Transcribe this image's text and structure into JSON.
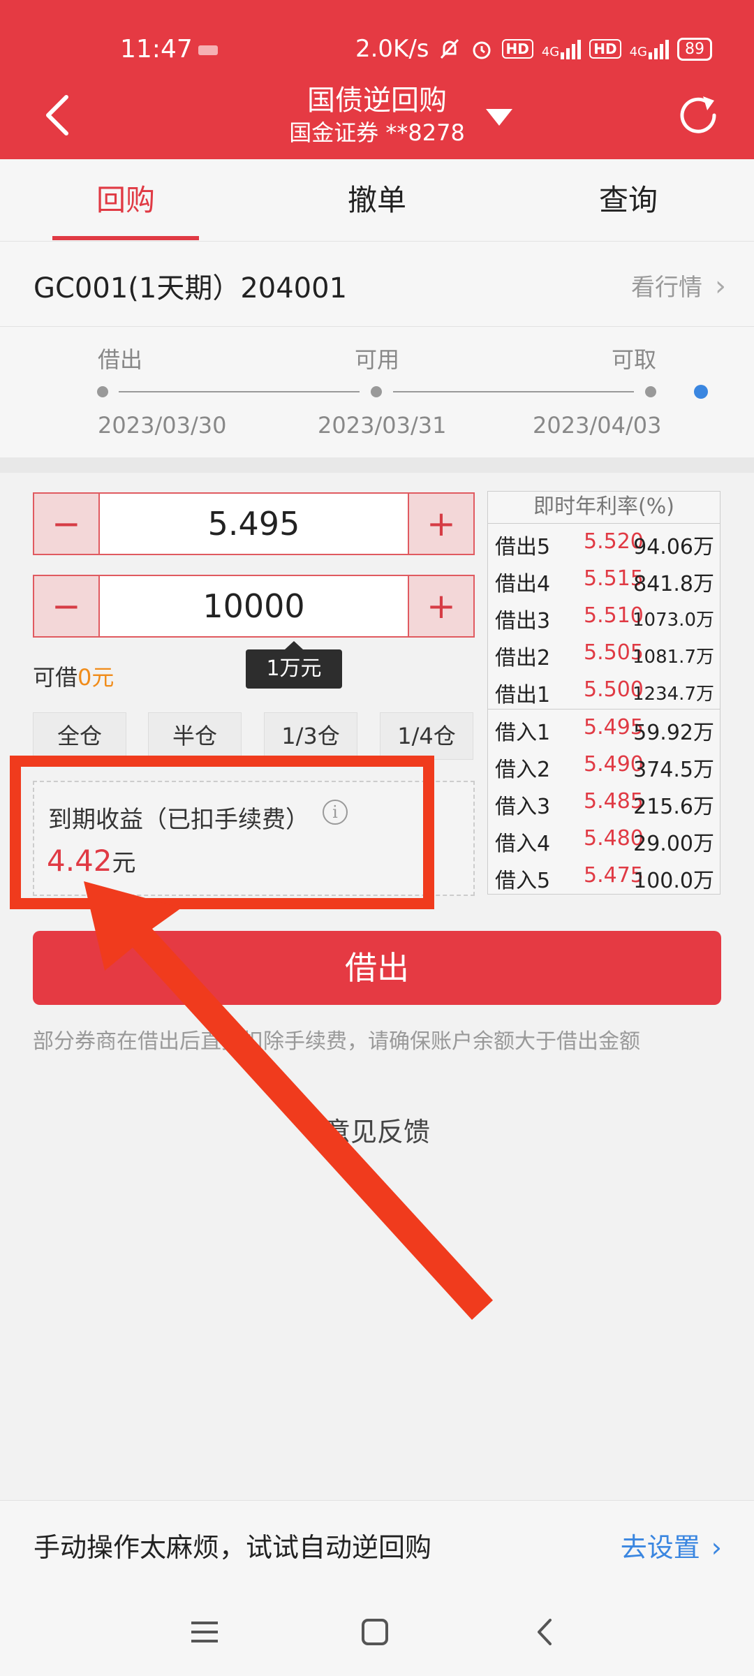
{
  "status_bar": {
    "time": "11:47",
    "net_speed": "2.0K/s",
    "hd1": "HD",
    "hd2": "HD",
    "sig1": "4G",
    "sig2": "4G",
    "battery": "89"
  },
  "header": {
    "title": "国债逆回购",
    "subtitle": "国金证券 **8278",
    "back_icon": "back-arrow-icon",
    "dropdown_icon": "triangle-down-icon",
    "refresh_icon": "refresh-icon"
  },
  "tabs": [
    {
      "label": "回购",
      "active": true
    },
    {
      "label": "撤单",
      "active": false
    },
    {
      "label": "查询",
      "active": false
    }
  ],
  "product": {
    "name": "GC001(1天期）204001",
    "link": "看行情",
    "link_icon": "chevron-right-icon"
  },
  "timeline": {
    "labels": [
      "借出",
      "可用",
      "可取"
    ],
    "dates": [
      "2023/03/30",
      "2023/03/31",
      "2023/04/03"
    ]
  },
  "rate_input": {
    "value": "5.495",
    "minus": "−",
    "plus": "+"
  },
  "amount_input": {
    "value": "10000",
    "minus": "−",
    "plus": "+"
  },
  "amount_tooltip": "1万元",
  "available": {
    "label": "可借",
    "value": "0元"
  },
  "ratio_buttons": [
    "全仓",
    "半仓",
    "1/3仓",
    "1/4仓"
  ],
  "income": {
    "label": "到期收益（已扣手续费）",
    "value": "4.42",
    "unit": "元",
    "info_icon": "info-icon"
  },
  "order_book": {
    "title": "即时年利率(%)",
    "asks": [
      {
        "side": "借出5",
        "rate": "5.520",
        "volume": "94.06万"
      },
      {
        "side": "借出4",
        "rate": "5.515",
        "volume": "841.8万"
      },
      {
        "side": "借出3",
        "rate": "5.510",
        "volume": "1073.0万"
      },
      {
        "side": "借出2",
        "rate": "5.505",
        "volume": "1081.7万"
      },
      {
        "side": "借出1",
        "rate": "5.500",
        "volume": "1234.7万"
      }
    ],
    "bids": [
      {
        "side": "借入1",
        "rate": "5.495",
        "volume": "59.92万"
      },
      {
        "side": "借入2",
        "rate": "5.490",
        "volume": "374.5万"
      },
      {
        "side": "借入3",
        "rate": "5.485",
        "volume": "215.6万"
      },
      {
        "side": "借入4",
        "rate": "5.480",
        "volume": "29.00万"
      },
      {
        "side": "借入5",
        "rate": "5.475",
        "volume": "100.0万"
      }
    ]
  },
  "lend_button": "借出",
  "note": "部分券商在借出后直接扣除手续费，请确保账户余额大于借出金额",
  "feedback": "意见反馈",
  "promo": {
    "text": "手动操作太麻烦，试试自动逆回购",
    "link": "去设置"
  },
  "annotation": {
    "color": "#f03b1d"
  },
  "colors": {
    "brand": "#e53a43",
    "accent_orange": "#f08c1a",
    "link_blue": "#3a86e0"
  }
}
